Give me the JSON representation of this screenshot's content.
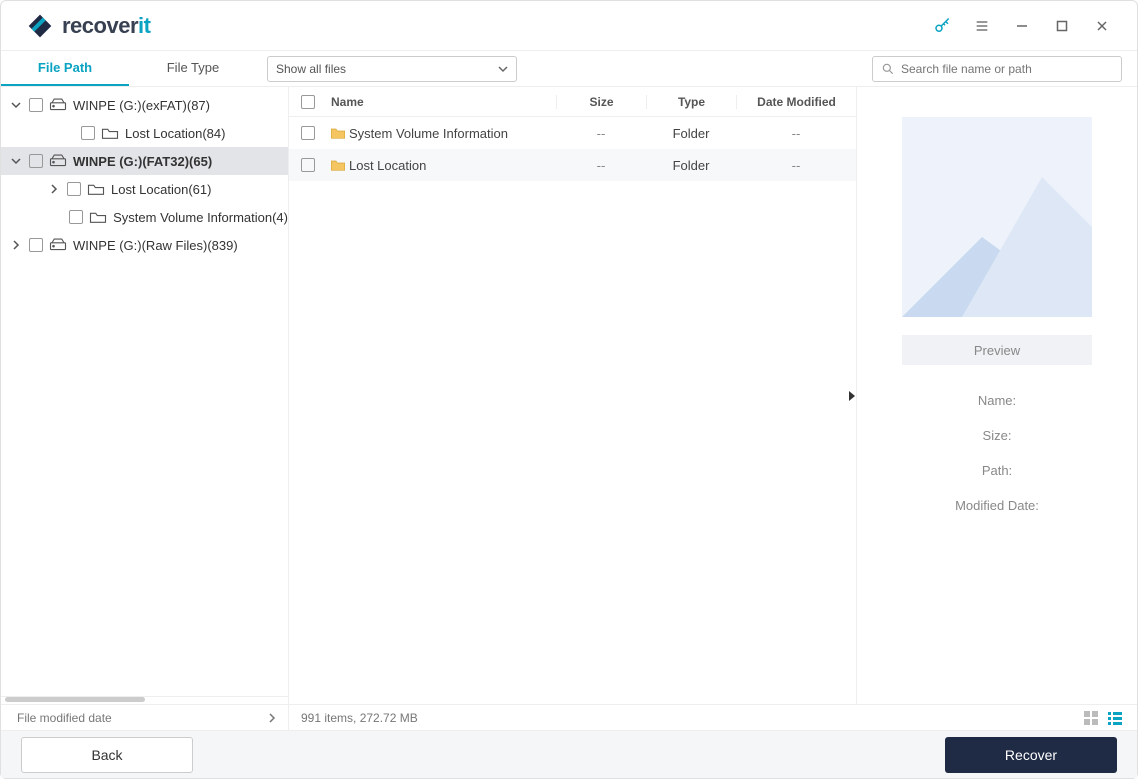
{
  "app": {
    "brand1": "recover",
    "brand2": "it"
  },
  "tabs": {
    "file_path": "File Path",
    "file_type": "File Type"
  },
  "filter": {
    "label": "Show all files"
  },
  "search": {
    "placeholder": "Search file name or path"
  },
  "tree": [
    {
      "label": "WINPE (G:)(exFAT)(87)",
      "lvl": 0,
      "expanded": true,
      "selected": false,
      "icon": "drive"
    },
    {
      "label": "Lost Location(84)",
      "lvl": 1,
      "expanded": null,
      "selected": false,
      "icon": "folder"
    },
    {
      "label": "WINPE (G:)(FAT32)(65)",
      "lvl": 0,
      "expanded": true,
      "selected": true,
      "icon": "drive"
    },
    {
      "label": "Lost Location(61)",
      "lvl": 1,
      "expanded": false,
      "selected": false,
      "icon": "folder"
    },
    {
      "label": "System Volume Information(4)",
      "lvl": 1,
      "expanded": null,
      "selected": false,
      "icon": "folder"
    },
    {
      "label": "WINPE (G:)(Raw Files)(839)",
      "lvl": 0,
      "expanded": false,
      "selected": false,
      "icon": "drive"
    }
  ],
  "columns": {
    "name": "Name",
    "size": "Size",
    "type": "Type",
    "date": "Date Modified"
  },
  "rows": [
    {
      "name": "System Volume Information",
      "size": "--",
      "type": "Folder",
      "date": "--"
    },
    {
      "name": "Lost Location",
      "size": "--",
      "type": "Folder",
      "date": "--"
    }
  ],
  "preview": {
    "button": "Preview",
    "meta": {
      "name": "Name:",
      "size": "Size:",
      "path": "Path:",
      "modified": "Modified Date:"
    }
  },
  "status": {
    "left": "File modified date",
    "mid": "991 items, 272.72  MB"
  },
  "footer": {
    "back": "Back",
    "recover": "Recover"
  }
}
